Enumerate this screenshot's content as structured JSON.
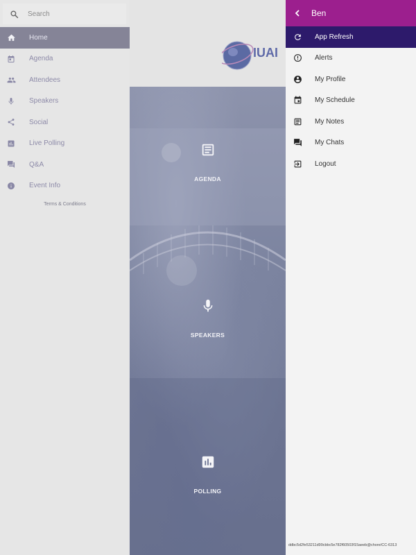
{
  "search": {
    "placeholder": "Search"
  },
  "sidebar": {
    "items": [
      {
        "label": "Home",
        "icon": "home-icon",
        "active": true
      },
      {
        "label": "Agenda",
        "icon": "calendar-icon"
      },
      {
        "label": "Attendees",
        "icon": "people-icon"
      },
      {
        "label": "Speakers",
        "icon": "microphone-icon"
      },
      {
        "label": "Social",
        "icon": "share-icon"
      },
      {
        "label": "Live Polling",
        "icon": "bar-chart-icon"
      },
      {
        "label": "Q&A",
        "icon": "forum-icon"
      },
      {
        "label": "Event Info",
        "icon": "info-icon"
      }
    ],
    "terms_label": "Terms & Conditions"
  },
  "header": {
    "logo_text": "IUAI"
  },
  "tiles": [
    {
      "label": "AGENDA",
      "icon": "notes-icon"
    },
    {
      "label": "SPEAKERS",
      "icon": "microphone-icon"
    },
    {
      "label": "POLLING",
      "icon": "bar-chart-icon"
    }
  ],
  "drawer": {
    "title": "Ben",
    "items": [
      {
        "label": "App Refresh",
        "icon": "refresh-icon",
        "highlight": true
      },
      {
        "label": "Alerts",
        "icon": "alert-icon"
      },
      {
        "label": "My Profile",
        "icon": "account-icon"
      },
      {
        "label": "My Schedule",
        "icon": "event-icon"
      },
      {
        "label": "My Notes",
        "icon": "notes-icon"
      },
      {
        "label": "My Chats",
        "icon": "chat-icon"
      },
      {
        "label": "Logout",
        "icon": "logout-icon"
      }
    ],
    "build_id": "ddbc5d2fe53211d99cbbc5e782f60503f15aeeb@chore/CC-6313"
  },
  "colors": {
    "accent": "#9c1f8e",
    "highlight": "#2d1a6b",
    "active_nav": "#858497"
  }
}
